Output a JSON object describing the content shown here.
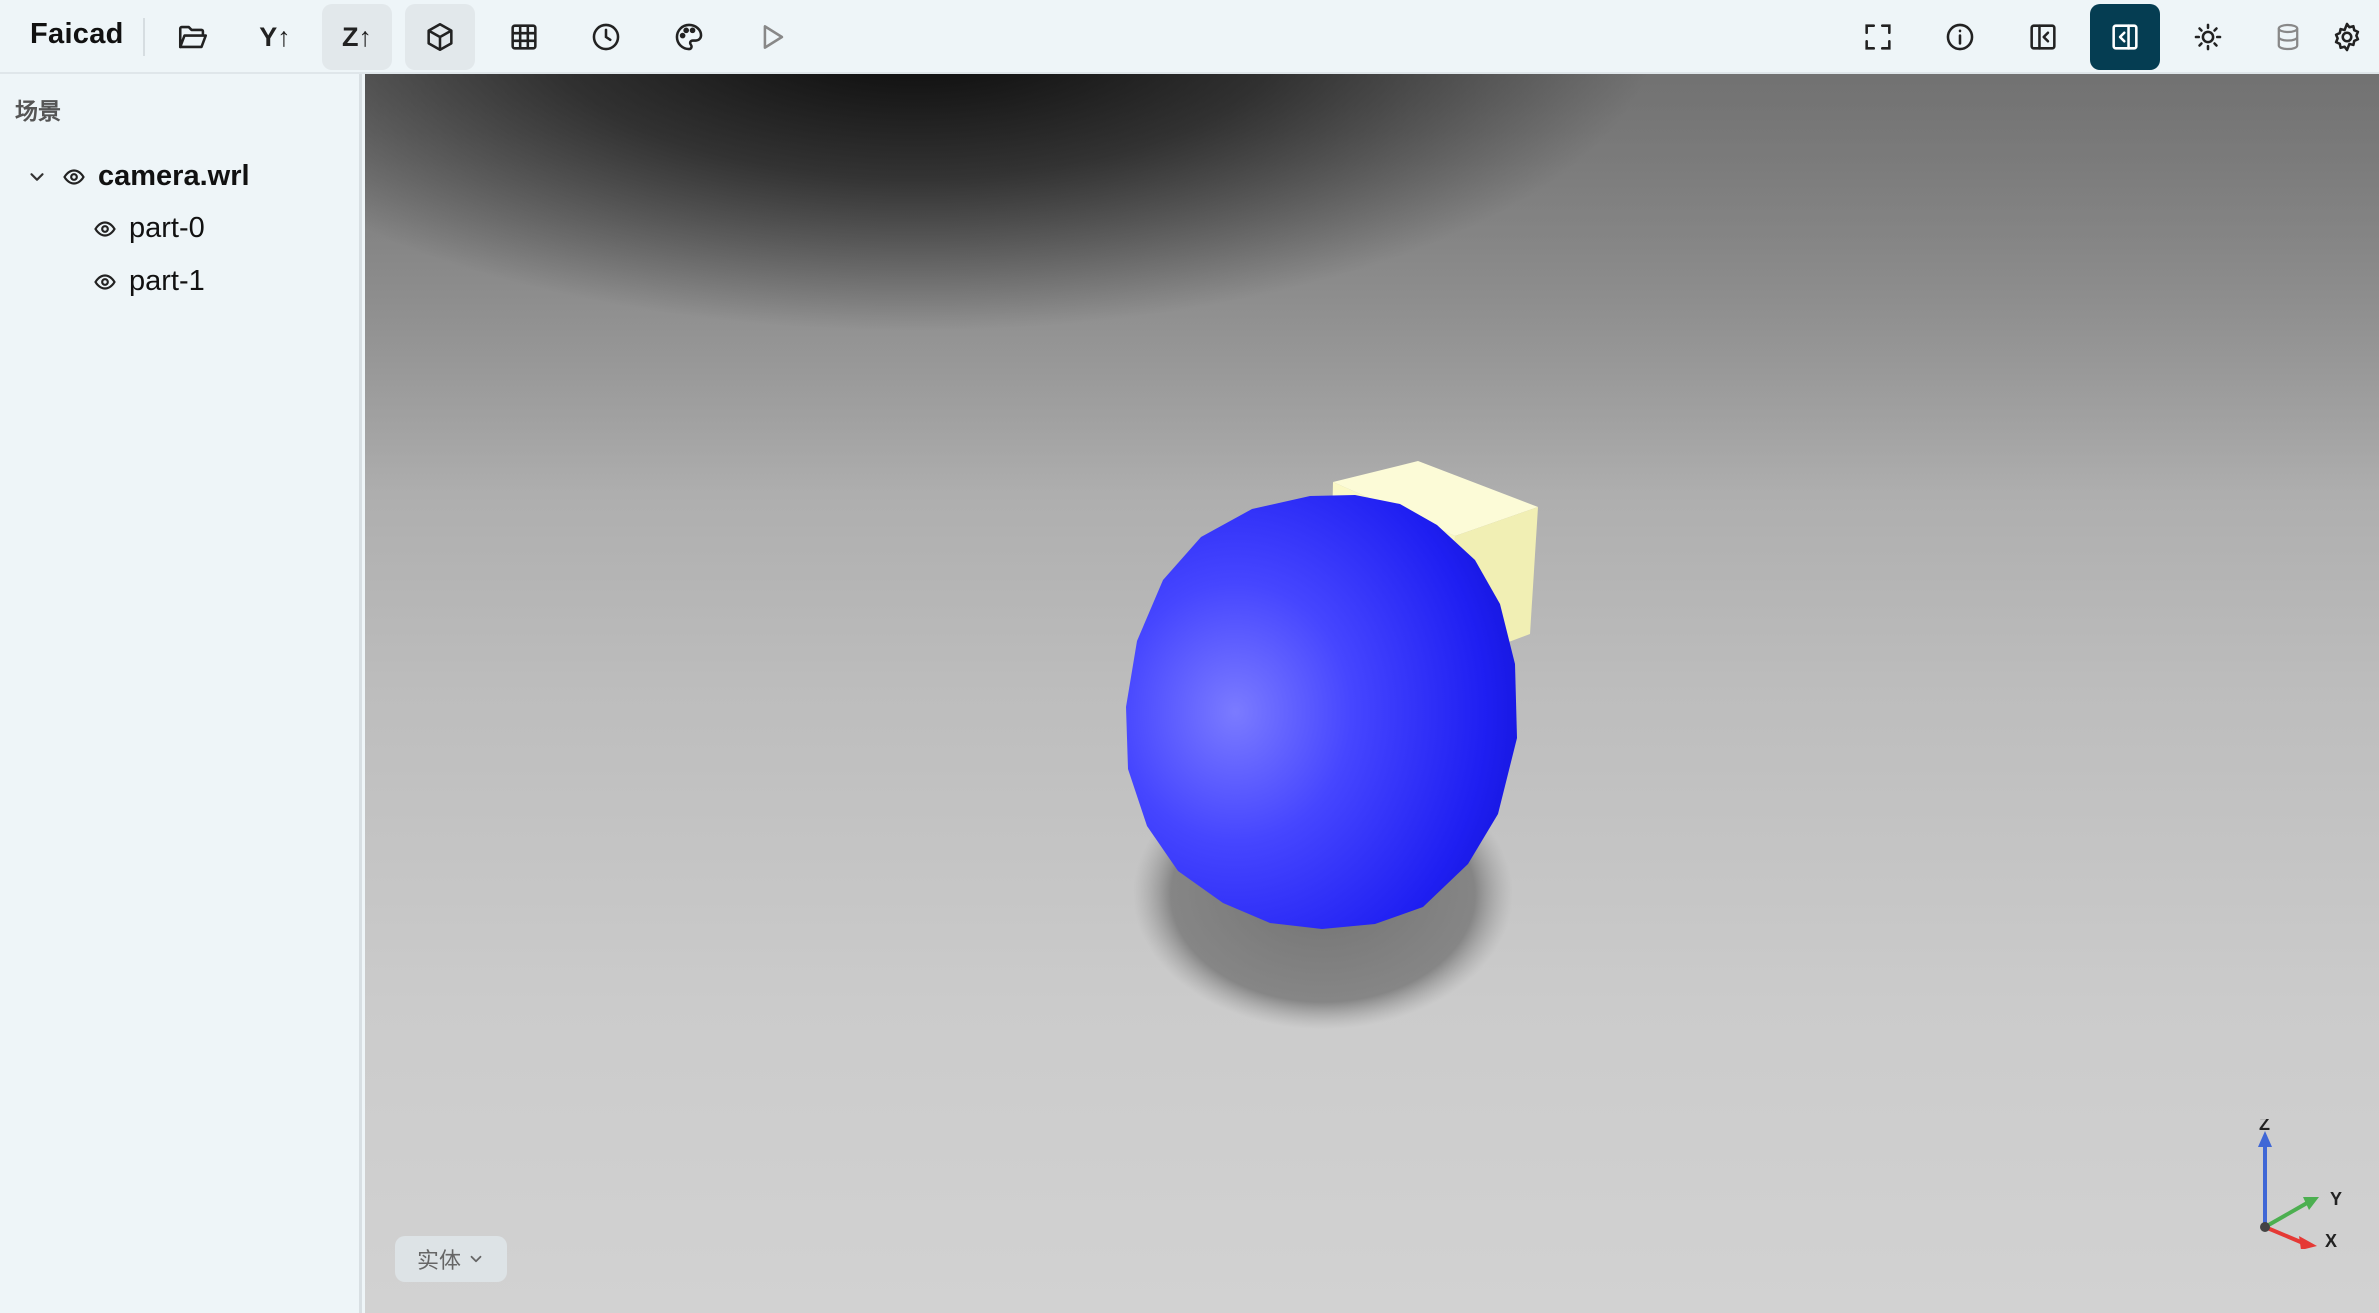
{
  "app": {
    "name": "Faicad"
  },
  "toolbar": {
    "left_buttons": [
      {
        "name": "open-folder-icon"
      },
      {
        "name": "y-up-button",
        "label": "Y↑"
      },
      {
        "name": "z-up-button",
        "label": "Z↑"
      },
      {
        "name": "cube-icon"
      },
      {
        "name": "grid-icon"
      },
      {
        "name": "clock-icon"
      },
      {
        "name": "palette-icon"
      },
      {
        "name": "play-icon"
      }
    ],
    "right_buttons": [
      {
        "name": "fullscreen-icon"
      },
      {
        "name": "info-icon"
      },
      {
        "name": "panel-left-icon"
      },
      {
        "name": "panel-right-icon",
        "active": true
      },
      {
        "name": "sun-icon"
      },
      {
        "name": "database-icon"
      },
      {
        "name": "gear-icon"
      }
    ],
    "active_color": "#053d52"
  },
  "sidebar": {
    "title": "场景",
    "tree": {
      "root": {
        "label": "camera.wrl",
        "expanded": true
      },
      "children": [
        {
          "label": "part-0"
        },
        {
          "label": "part-1"
        }
      ]
    }
  },
  "viewport": {
    "mode_label": "实体",
    "objects": [
      {
        "name": "sphere",
        "color": "#2626ff"
      },
      {
        "name": "cube",
        "color": "#fbf8c8"
      }
    ],
    "axes": {
      "z": "Z",
      "y": "Y",
      "x": "X",
      "z_color": "#3f67d6",
      "y_color": "#4caf50",
      "x_color": "#e53935"
    }
  }
}
